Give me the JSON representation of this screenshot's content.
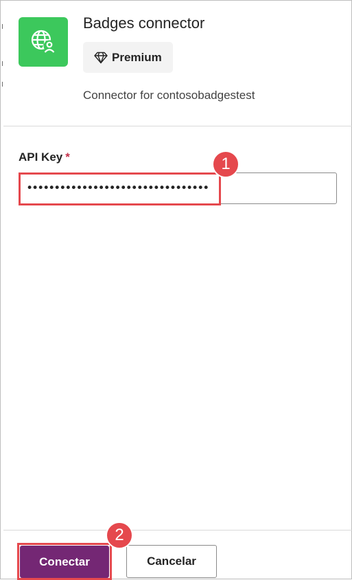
{
  "connector": {
    "name": "Badges connector",
    "tier_label": "Premium",
    "tier_icon": "diamond-icon",
    "description": "Connector for contosobadgestest",
    "icon": "globe-user-icon",
    "icon_color": "#3cc85c"
  },
  "form": {
    "api_key_label": "API Key",
    "required_marker": "*",
    "api_key_value": "•••••••••••••••••••••••••••••••••"
  },
  "actions": {
    "connect_label": "Conectar",
    "cancel_label": "Cancelar",
    "primary_color": "#742774"
  },
  "annotations": {
    "step_1": "1",
    "step_2": "2",
    "highlight_color": "#e5484d"
  }
}
